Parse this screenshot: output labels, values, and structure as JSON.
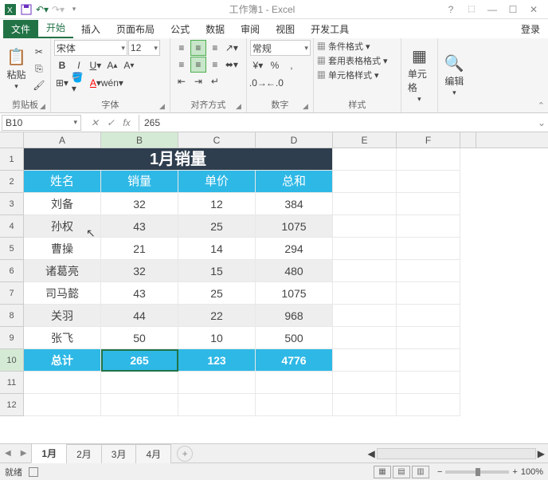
{
  "app": {
    "title": "工作簿1 - Excel"
  },
  "tabs": {
    "file": "文件",
    "home": "开始",
    "insert": "插入",
    "layout": "页面布局",
    "formula": "公式",
    "data": "数据",
    "review": "审阅",
    "view": "视图",
    "dev": "开发工具",
    "login": "登录"
  },
  "ribbon": {
    "clipboard": {
      "label": "剪贴板",
      "paste": "粘贴"
    },
    "font": {
      "label": "字体",
      "name": "宋体",
      "size": "12"
    },
    "align": {
      "label": "对齐方式"
    },
    "number": {
      "label": "数字",
      "format": "常规"
    },
    "style": {
      "label": "样式",
      "cond": "条件格式",
      "table": "套用表格格式",
      "cell": "单元格样式"
    },
    "cells": {
      "label": "单元格"
    },
    "edit": {
      "label": "编辑"
    }
  },
  "namebox": "B10",
  "formula": "265",
  "columns": [
    "A",
    "B",
    "C",
    "D",
    "E",
    "F"
  ],
  "sheet": {
    "title": "1月销量",
    "headers": [
      "姓名",
      "销量",
      "单价",
      "总和"
    ],
    "rows": [
      {
        "name": "刘备",
        "qty": "32",
        "price": "12",
        "total": "384"
      },
      {
        "name": "孙权",
        "qty": "43",
        "price": "25",
        "total": "1075"
      },
      {
        "name": "曹操",
        "qty": "21",
        "price": "14",
        "total": "294"
      },
      {
        "name": "诸葛亮",
        "qty": "32",
        "price": "15",
        "total": "480"
      },
      {
        "name": "司马懿",
        "qty": "43",
        "price": "25",
        "total": "1075"
      },
      {
        "name": "关羽",
        "qty": "44",
        "price": "22",
        "total": "968"
      },
      {
        "name": "张飞",
        "qty": "50",
        "price": "10",
        "total": "500"
      }
    ],
    "totals": {
      "label": "总计",
      "qty": "265",
      "price": "123",
      "total": "4776"
    }
  },
  "sheettabs": [
    "1月",
    "2月",
    "3月",
    "4月"
  ],
  "status": {
    "ready": "就绪",
    "zoom": "100%"
  }
}
